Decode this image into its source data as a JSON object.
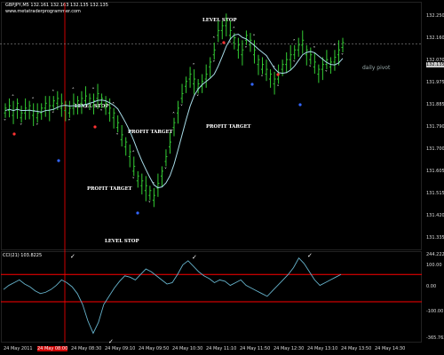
{
  "window": {
    "symbol_header": "GBPJPY,M5  132.161 132.163 132.135 132.135",
    "website": "www.metatraderprogrammer.com",
    "indicator_header": "CCI(21) 103.8225"
  },
  "annotations": {
    "level_stop_1": "LEVEL STOP",
    "level_stop_2": "LEVEL STOP",
    "level_stop_3": "LEVEL STOP",
    "profit_target_1": "PROFIT TARGET",
    "profit_target_2": "PROFIT TARGET",
    "profit_target_3": "PROFIT TARGET",
    "daily_pivot": "daily pivot"
  },
  "price_axis": [
    "132.250",
    "132.160",
    "132.070",
    "131.975",
    "131.885",
    "131.790",
    "131.700",
    "131.605",
    "131.515",
    "131.420",
    "131.335"
  ],
  "price_axis_current": "132.135",
  "cci_axis": [
    "244.2224",
    "100.00",
    "0.00",
    "-100.00",
    "-365.7634"
  ],
  "time_axis": [
    "24 May 2011",
    "24 May 08:00",
    "24 May 08:30",
    "24 May 09:10",
    "24 May 09:50",
    "24 May 10:30",
    "24 May 11:10",
    "24 May 11:50",
    "24 May 12:30",
    "24 May 13:10",
    "24 May 13:50",
    "24 May 14:30"
  ],
  "colors": {
    "bar": "#33cc33",
    "ma": "#a8dce8",
    "cci_line": "#66b3cc",
    "cci_levels": "#ff0000",
    "current_line": "#888888",
    "vline": "#ff0000"
  },
  "chart_data": {
    "type": "bar",
    "title": "GBPJPY,M5  132.161 132.163 132.135 132.135",
    "ylim": [
      131.335,
      132.25
    ],
    "series": [
      {
        "values": [
          131.86,
          131.87,
          131.85,
          131.88,
          131.84,
          131.86,
          131.87,
          131.85,
          131.84,
          131.86,
          131.88,
          131.87,
          131.89,
          131.9,
          131.88,
          131.87,
          131.86,
          131.88,
          131.89,
          131.9,
          131.91,
          131.9,
          131.89,
          131.92,
          131.9,
          131.88,
          131.86,
          131.84,
          131.8,
          131.75,
          131.72,
          131.68,
          131.62,
          131.58,
          131.56,
          131.54,
          131.52,
          131.5,
          131.55,
          131.6,
          131.66,
          131.72,
          131.8,
          131.86,
          131.92,
          131.97,
          132.0,
          131.98,
          131.96,
          131.97,
          132.0,
          132.05,
          132.1,
          132.18,
          132.2,
          132.22,
          132.18,
          132.15,
          132.12,
          132.1,
          132.16,
          132.14,
          132.1,
          132.06,
          132.04,
          132.02,
          132.0,
          131.98,
          132.0,
          132.04,
          132.06,
          132.08,
          132.1,
          132.12,
          132.14,
          132.1,
          132.08,
          132.05,
          132.02,
          132.04,
          132.06,
          132.05,
          132.07,
          132.1,
          132.13
        ]
      }
    ],
    "cci": [
      -10,
      20,
      40,
      60,
      30,
      10,
      -20,
      -40,
      -30,
      -10,
      20,
      60,
      40,
      10,
      -40,
      -120,
      -240,
      -330,
      -250,
      -120,
      -60,
      0,
      50,
      90,
      80,
      60,
      100,
      140,
      120,
      90,
      60,
      30,
      40,
      100,
      170,
      200,
      160,
      120,
      90,
      70,
      40,
      60,
      50,
      20,
      40,
      60,
      20,
      0,
      -20,
      -40,
      -60,
      -20,
      20,
      60,
      100,
      150,
      220,
      180,
      120,
      60,
      20,
      40,
      60,
      80,
      100
    ]
  }
}
